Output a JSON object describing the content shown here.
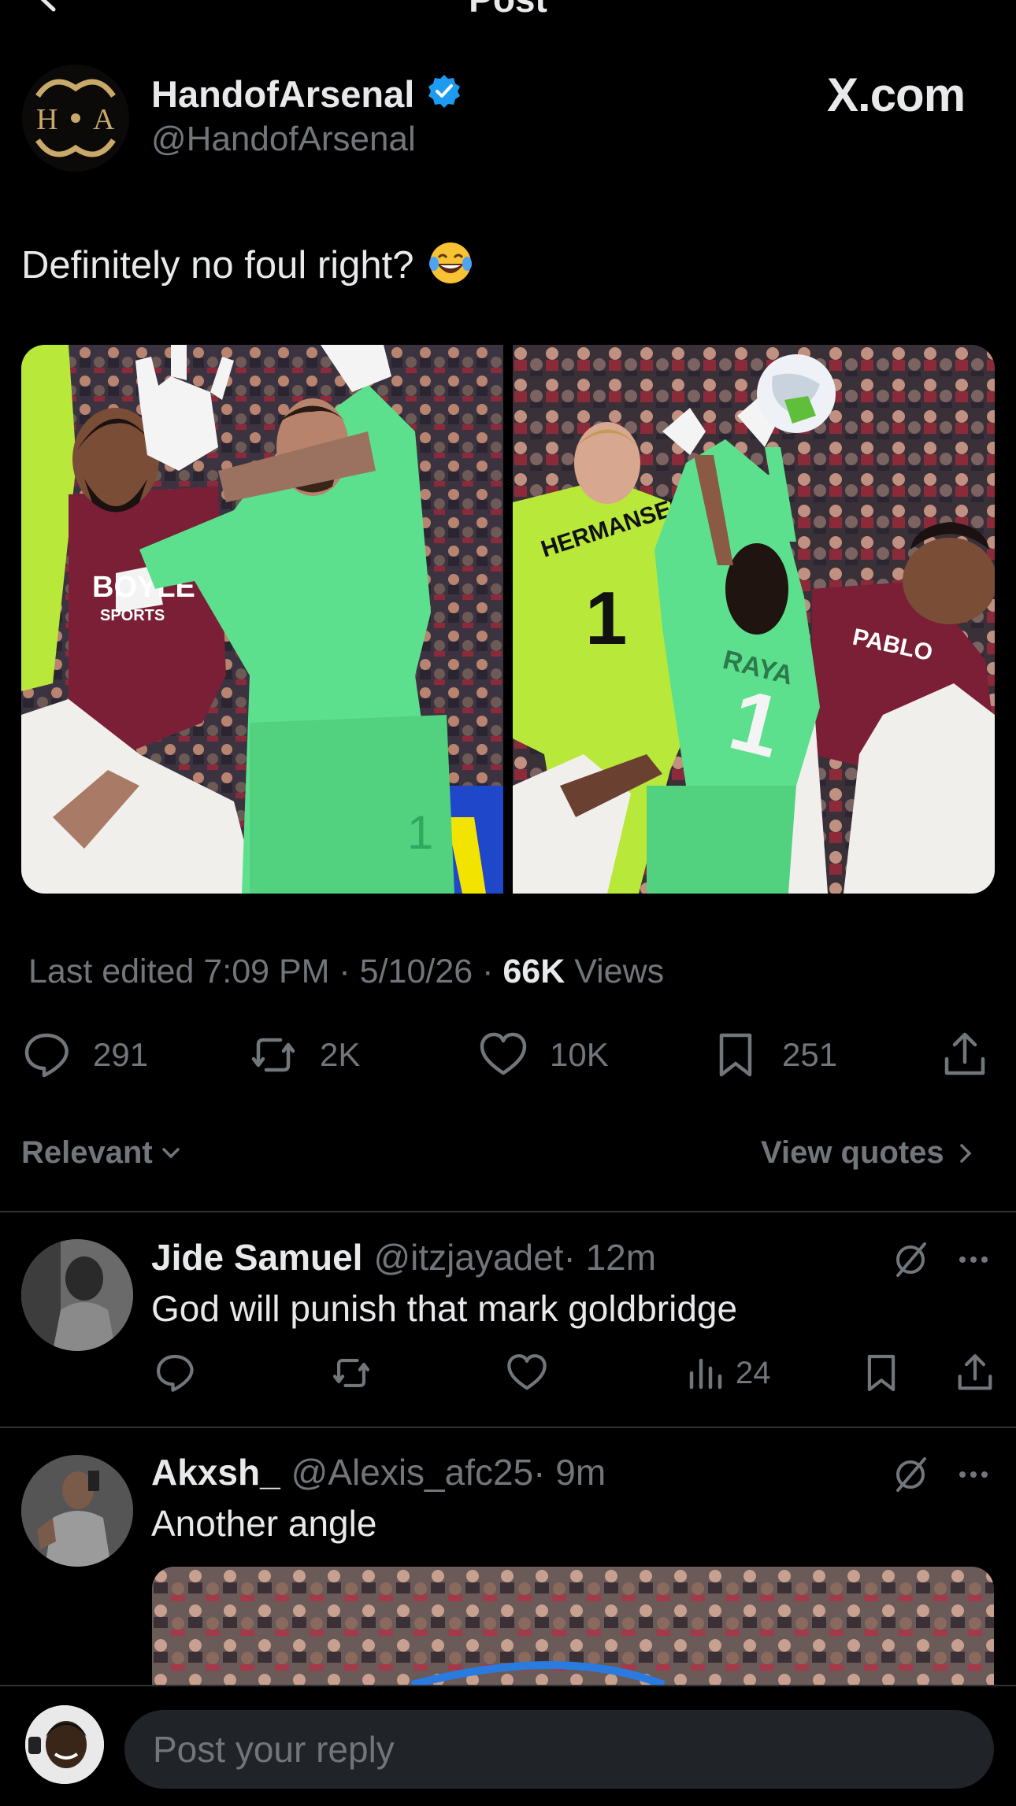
{
  "header": {
    "title": "Post"
  },
  "author": {
    "name": "HandofArsenal",
    "handle": "@HandofArsenal",
    "avatar_text": "H A"
  },
  "watermark": "X.com",
  "post": {
    "text": "Definitely no foul right?",
    "emoji": "face-with-tears-of-joy-icon",
    "photo_left_jersey": "1",
    "photo_right_jersey_back": "HERMANSEN",
    "photo_right_jersey_number": "1",
    "photo_right_name": "RAYA",
    "photo_right_other": "PABLO",
    "photo_left_sponsor": "BOYLE SPORTS"
  },
  "meta": {
    "edited": "Last edited 7:09 PM · 5/10/26 · ",
    "views_count": "66K",
    "views_label": " Views"
  },
  "actions": {
    "replies": "291",
    "reposts": "2K",
    "likes": "10K",
    "bookmarks": "251"
  },
  "sort": {
    "label": "Relevant",
    "view_quotes": "View quotes"
  },
  "replies": [
    {
      "name": "Jide Samuel",
      "handle": "@itzjayadet",
      "time": "· 12m",
      "text": "God will punish that mark goldbridge",
      "views": "24"
    },
    {
      "name": "Akxsh_",
      "handle": "@Alexis_afc25",
      "time": "· 9m",
      "text": "Another angle"
    }
  ],
  "composer": {
    "placeholder": "Post your reply"
  },
  "colors": {
    "accent": "#1d9bf0",
    "muted": "#71767b",
    "text": "#e7e9ea",
    "background": "#000000",
    "keeper_kit": "#5de08e",
    "claret": "#7a1f35"
  }
}
